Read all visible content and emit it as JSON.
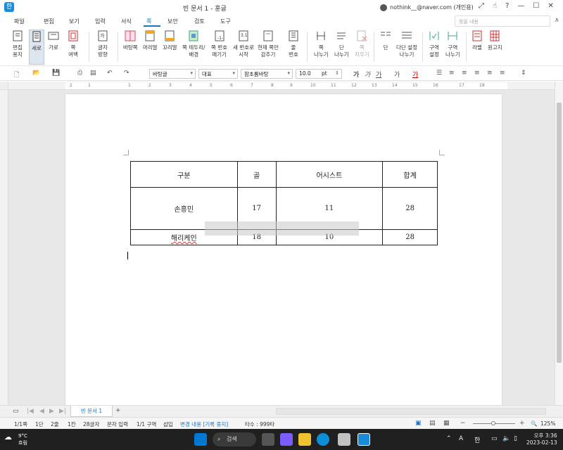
{
  "window": {
    "title": "빈 문서 1 - 훈글",
    "user": "nothink__@naver.com (개인용)",
    "app_icon_glyph": "한"
  },
  "menu": {
    "items": [
      "파일",
      "편집",
      "보기",
      "입력",
      "서식",
      "쪽",
      "보안",
      "검토",
      "도구"
    ],
    "active": "쪽",
    "search_placeholder": "찾을 내용"
  },
  "ribbon": {
    "buttons": [
      {
        "label": "편집\n용지",
        "icon": "page-setup-icon"
      },
      {
        "label": "세로",
        "icon": "portrait-icon",
        "selected": true
      },
      {
        "label": "가로",
        "icon": "landscape-icon"
      },
      {
        "label": "쪽\n여백",
        "icon": "margin-icon"
      },
      {
        "label": "글자\n방향",
        "icon": "text-direction-icon"
      },
      {
        "label": "바탕쪽",
        "icon": "master-page-icon"
      },
      {
        "label": "머리말",
        "icon": "header-icon"
      },
      {
        "label": "꼬리말",
        "icon": "footer-icon"
      },
      {
        "label": "쪽 테두리/\n배경",
        "icon": "page-border-icon"
      },
      {
        "label": "쪽 번호\n매기기",
        "icon": "page-number-icon"
      },
      {
        "label": "새 번호로\n시작",
        "icon": "new-number-icon"
      },
      {
        "label": "현재 쪽만\n감추기",
        "icon": "hide-icon"
      },
      {
        "label": "줄\n번호",
        "icon": "line-number-icon"
      },
      {
        "label": "쪽\n나누기",
        "icon": "page-break-icon"
      },
      {
        "label": "단\n나누기",
        "icon": "column-break-icon"
      },
      {
        "label": "쪽\n지우기",
        "icon": "delete-page-icon",
        "disabled": true
      },
      {
        "label": "단",
        "icon": "columns-icon"
      },
      {
        "label": "다단 설정\n나누기",
        "icon": "multi-column-icon"
      },
      {
        "label": "구역\n설정",
        "icon": "section-setup-icon"
      },
      {
        "label": "구역\n나누기",
        "icon": "section-break-icon"
      },
      {
        "label": "라벨",
        "icon": "label-icon"
      },
      {
        "label": "원고지",
        "icon": "manuscript-icon"
      }
    ]
  },
  "format": {
    "style_value": "바탕글",
    "lang_value": "대표",
    "font_value": "함초롬바탕",
    "size_value": "10.0",
    "size_unit": "pt"
  },
  "ruler": {
    "numbers": [
      "2",
      "1",
      "",
      "1",
      "2",
      "3",
      "4",
      "5",
      "6",
      "7",
      "8",
      "9",
      "10",
      "11",
      "12",
      "13",
      "14",
      "15",
      "16",
      "17",
      "18"
    ]
  },
  "table": {
    "headers": [
      "구분",
      "골",
      "어시스트",
      "합계"
    ],
    "rows": [
      [
        "손흥민",
        "17",
        "11",
        "28"
      ],
      [
        "해리케인",
        "18",
        "10",
        "28"
      ]
    ]
  },
  "tabs": {
    "doc_tab": "빈 문서 1"
  },
  "status": {
    "page": "1/1쪽",
    "column": "1단",
    "line": "2줄",
    "char": "1칸",
    "count": "28글자",
    "mode": "문자 입력",
    "section": "1/1 구역",
    "insert": "삽입",
    "track": "변경 내용 [기록 중지]",
    "strokes": "타수 : 999타",
    "zoom": "125%"
  },
  "taskbar": {
    "temp": "9°C",
    "weather": "흐림",
    "search": "검색",
    "lang": "A",
    "ime": "한",
    "time": "오후 3:36",
    "date": "2023-02-13"
  }
}
